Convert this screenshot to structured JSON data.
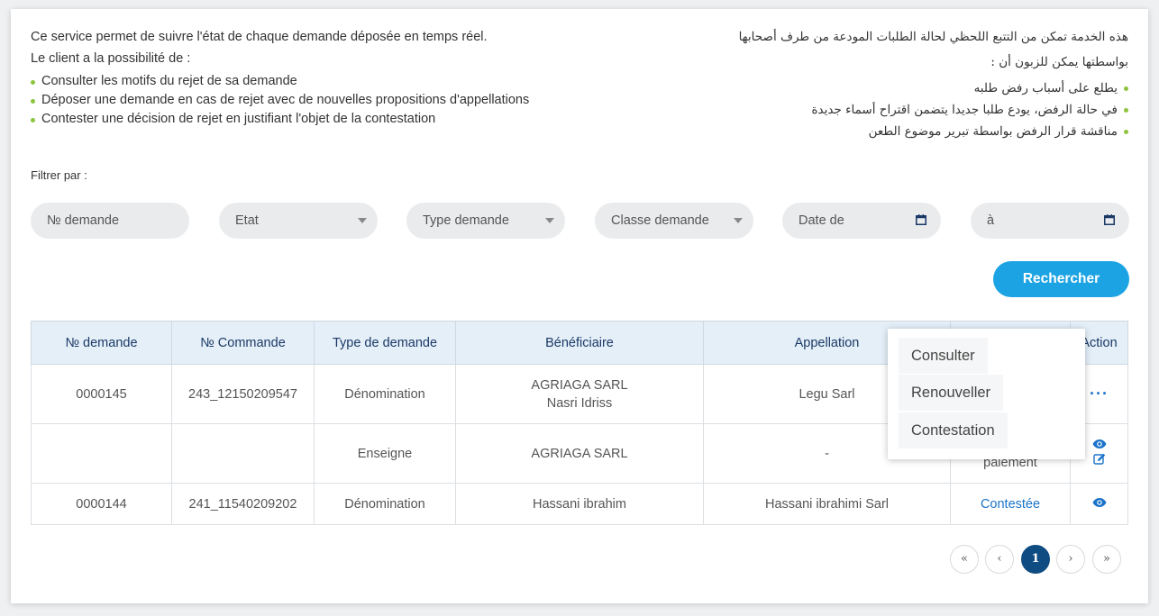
{
  "intro": {
    "fr_line1": "Ce service permet de suivre l'état de chaque demande déposée en temps réel.",
    "fr_line2": "Le client a la possibilité de :",
    "fr_bullets": [
      "Consulter les motifs du rejet de sa demande",
      "Déposer une demande en cas de rejet avec de nouvelles propositions d'appellations",
      "Contester une décision de rejet en justifiant l'objet de la contestation"
    ],
    "ar_line1": "هذه الخدمة تمكن من التتبع اللحظي لحالة الطلبات المودعة من طرف أصحابها",
    "ar_line2": "بواسطتها يمكن للزبون أن :",
    "ar_bullets": [
      "يطلع على أسباب رفض طلبه",
      "في حالة الرفض، يودع طلبا جديدا يتضمن اقتراح أسماء جديدة",
      "مناقشة قرار الرفض بواسطة تبرير موضوع الطعن"
    ]
  },
  "filters": {
    "label": "Filtrer par :",
    "num_demande": "№ demande",
    "etat": "Etat",
    "type_demande": "Type demande",
    "classe_demande": "Classe demande",
    "date_de": "Date de",
    "date_a": "à"
  },
  "search_button": "Rechercher",
  "table": {
    "headers": [
      "№ demande",
      "№ Commande",
      "Type de demande",
      "Bénéficiaire",
      "Appellation",
      "",
      "Action"
    ],
    "rows": [
      {
        "num": "0000145",
        "commande": "243_12150209547",
        "type": "Dénomination",
        "benef1": "AGRIAGA SARL",
        "benef2": "Nasri Idriss",
        "appellation": "Legu Sarl",
        "etat": "",
        "action": "..."
      },
      {
        "num": "",
        "commande": "",
        "type": "Enseigne",
        "benef1": "AGRIAGA SARL",
        "benef2": "",
        "appellation": "-",
        "etat": "paiement",
        "action": ""
      },
      {
        "num": "0000144",
        "commande": "241_11540209202",
        "type": "Dénomination",
        "benef1": "Hassani ibrahim",
        "benef2": "",
        "appellation": "Hassani ibrahimi Sarl",
        "etat": "Contestée",
        "action": ""
      }
    ]
  },
  "menu": {
    "items": [
      "Consulter",
      "Renouveller",
      "Contestation"
    ]
  },
  "pagination": {
    "first": "«",
    "prev": "‹",
    "current": "1",
    "next": "›",
    "last": "»"
  },
  "colors": {
    "accent": "#1ca3e3",
    "header_bg": "#e4eff8",
    "bullet": "#8cc43e",
    "pager_active": "#0f4c81"
  }
}
